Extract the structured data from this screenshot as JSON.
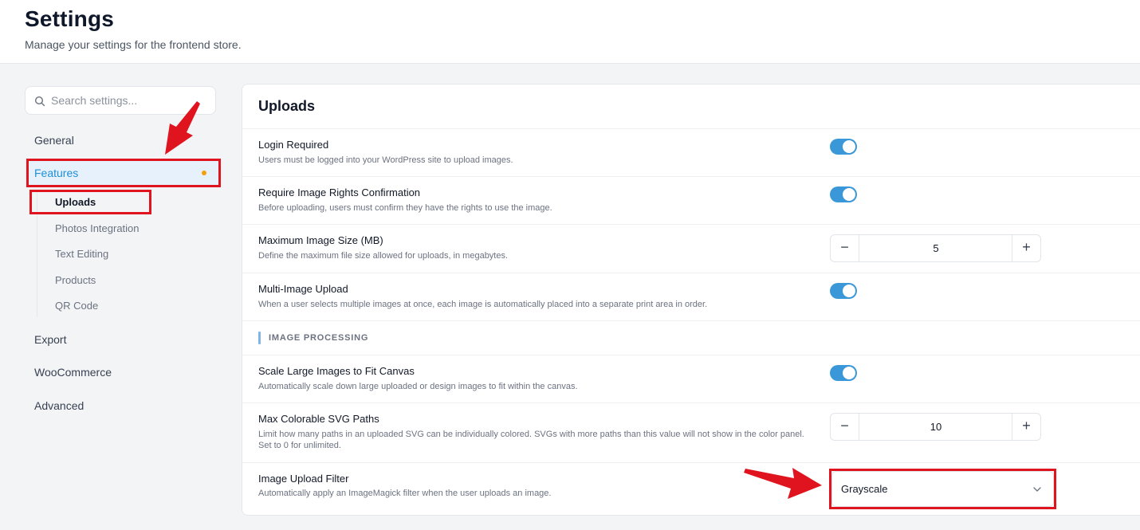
{
  "header": {
    "title": "Settings",
    "subtitle": "Manage your settings for the frontend store."
  },
  "sidebar": {
    "search_placeholder": "Search settings...",
    "items": [
      {
        "label": "General"
      },
      {
        "label": "Features",
        "active": true
      },
      {
        "label": "Export"
      },
      {
        "label": "WooCommerce"
      },
      {
        "label": "Advanced"
      }
    ],
    "subitems": [
      {
        "label": "Uploads",
        "active": true
      },
      {
        "label": "Photos Integration"
      },
      {
        "label": "Text Editing"
      },
      {
        "label": "Products"
      },
      {
        "label": "QR Code"
      }
    ]
  },
  "panel": {
    "title": "Uploads",
    "settings": [
      {
        "title": "Login Required",
        "desc": "Users must be logged into your WordPress site to upload images.",
        "control": "toggle",
        "enabled": true
      },
      {
        "title": "Require Image Rights Confirmation",
        "desc": "Before uploading, users must confirm they have the rights to use the image.",
        "control": "toggle",
        "enabled": true
      },
      {
        "title": "Maximum Image Size (MB)",
        "desc": "Define the maximum file size allowed for uploads, in megabytes.",
        "control": "stepper",
        "value": "5"
      },
      {
        "title": "Multi-Image Upload",
        "desc": "When a user selects multiple images at once, each image is automatically placed into a separate print area in order.",
        "control": "toggle",
        "enabled": true
      }
    ],
    "section": "IMAGE PROCESSING",
    "processing": [
      {
        "title": "Scale Large Images to Fit Canvas",
        "desc": "Automatically scale down large uploaded or design images to fit within the canvas.",
        "control": "toggle",
        "enabled": true
      },
      {
        "title": "Max Colorable SVG Paths",
        "desc": "Limit how many paths in an uploaded SVG can be individually colored. SVGs with more paths than this value will not show in the color panel. Set to 0 for unlimited.",
        "control": "stepper",
        "value": "10"
      },
      {
        "title": "Image Upload Filter",
        "desc": "Automatically apply an ImageMagick filter when the user uploads an image.",
        "control": "select",
        "value": "Grayscale"
      }
    ]
  },
  "stepper_labels": {
    "minus": "−",
    "plus": "+"
  },
  "colors": {
    "accent": "#3a97d8",
    "active_nav_text": "#1d8fd8",
    "active_nav_bg": "#e7f1fb",
    "status_dot": "#f59e0b",
    "annotation": "#e0141e"
  }
}
